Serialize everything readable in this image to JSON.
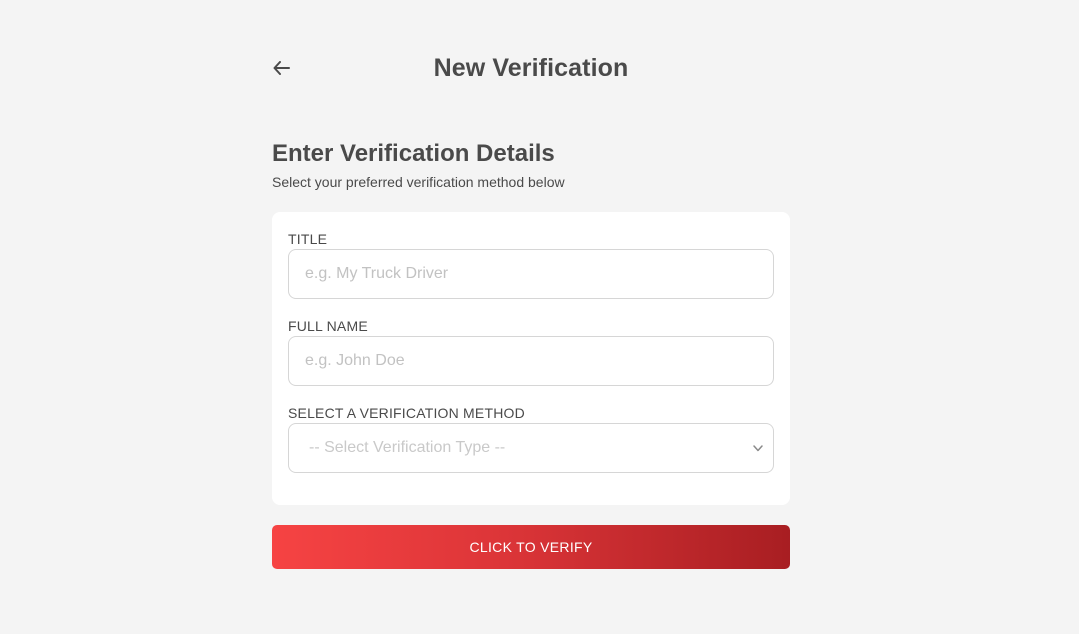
{
  "header": {
    "back_icon": "arrow-left-icon",
    "title": "New Verification"
  },
  "section": {
    "heading": "Enter Verification Details",
    "subheading": "Select your preferred verification method below"
  },
  "form": {
    "title_field": {
      "label": "TITLE",
      "placeholder": "e.g. My Truck Driver",
      "value": ""
    },
    "full_name_field": {
      "label": "FULL NAME",
      "placeholder": "e.g. John Doe",
      "value": ""
    },
    "method_field": {
      "label": "SELECT A VERIFICATION METHOD",
      "selected": "-- Select Verification Type --",
      "chevron_icon": "chevron-down-icon"
    }
  },
  "actions": {
    "verify_label": "CLICK TO VERIFY"
  },
  "colors": {
    "background": "#f4f4f4",
    "card": "#ffffff",
    "text": "#4a4a4a",
    "button_gradient_start": "#f64343",
    "button_gradient_end": "#a81e22"
  }
}
